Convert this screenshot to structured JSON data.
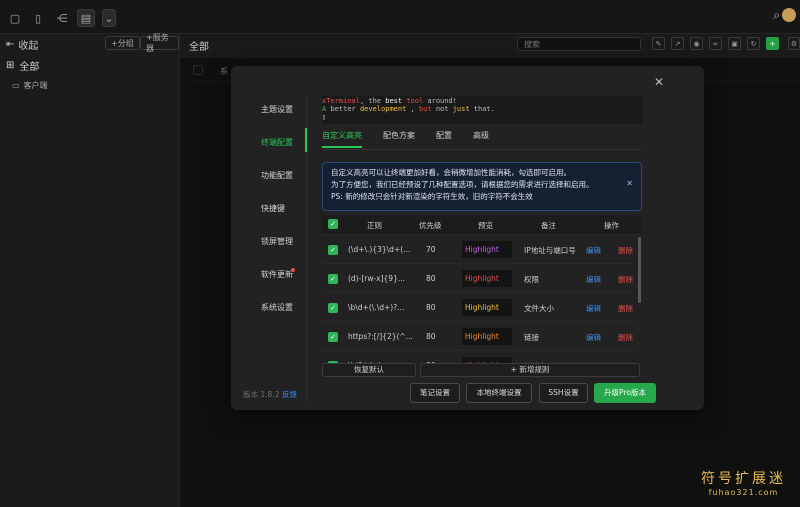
{
  "topbar": {
    "buttons": [
      "terminal-icon",
      "file-icon",
      "tree-icon",
      "list-icon",
      "chevron-down-icon"
    ]
  },
  "sidebar": {
    "collapse_label": "收起",
    "add_group_label": "+分组",
    "add_server_label": "+服务器",
    "all_label": "全部",
    "group_label": "客户端"
  },
  "main": {
    "title": "全部",
    "search_placeholder": "搜索",
    "head_partial": "系"
  },
  "modal": {
    "nav": [
      {
        "label": "主题设置"
      },
      {
        "label": "终端配置"
      },
      {
        "label": "功能配置"
      },
      {
        "label": "快捷键"
      },
      {
        "label": "锁屏管理"
      },
      {
        "label": "软件更新"
      },
      {
        "label": "系统设置"
      }
    ],
    "terminal_preview": {
      "line1": [
        {
          "t": "xTerminal",
          "c": "#e0504e"
        },
        {
          "t": ", the ",
          "c": "#bbbbbb"
        },
        {
          "t": "best",
          "c": "#f0f0f0"
        },
        {
          "t": " ",
          "c": "#bbbbbb"
        },
        {
          "t": "tool",
          "c": "#e0504e"
        },
        {
          "t": " around!",
          "c": "#bbbbbb"
        }
      ],
      "line2": [
        {
          "t": "A",
          "c": "#31c45b"
        },
        {
          "t": " better ",
          "c": "#bbbbbb"
        },
        {
          "t": "development",
          "c": "#f0c040"
        },
        {
          "t": " ",
          "c": "#bbbbbb"
        },
        {
          "t": ", ",
          "c": "#bbbbbb"
        },
        {
          "t": "but",
          "c": "#e0504e"
        },
        {
          "t": " not ",
          "c": "#bbbbbb"
        },
        {
          "t": "just",
          "c": "#f0c040"
        },
        {
          "t": " that.",
          "c": "#bbbbbb"
        }
      ],
      "cursor": "▯"
    },
    "tabs": [
      "自定义高亮",
      "配色方案",
      "配置",
      "高级"
    ],
    "info": {
      "line1": "自定义高亮可以让终端更加好看，会稍微增加性能消耗，勾选即可启用。",
      "line2": "为了方便您，我们已经预设了几种配置选项，请根据您的需求进行选择和启用。",
      "line3": "PS: 新的修改只会针对新渲染的字符生效，旧的字符不会生效"
    },
    "grid": {
      "headers": [
        "正则",
        "优先级",
        "预览",
        "备注",
        "操作"
      ],
      "rows": [
        {
          "regex": "(\\d+\\.){3}\\d+(...",
          "priority": "70",
          "preview": "Highlight",
          "preview_color": "#c060e0",
          "note": "IP地址与端口号",
          "edit": "编辑",
          "del": "删除"
        },
        {
          "regex": "(d)-[rw-x]{9}...",
          "priority": "80",
          "preview": "Highlight",
          "preview_color": "#e0504e",
          "note": "权限",
          "edit": "编辑",
          "del": "删除"
        },
        {
          "regex": "\\b\\d+(\\.\\d+)?...",
          "priority": "80",
          "preview": "Highlight",
          "preview_color": "#f0c040",
          "note": "文件大小",
          "edit": "编辑",
          "del": "删除"
        },
        {
          "regex": "https?:[/]{2}(^...",
          "priority": "80",
          "preview": "Highlight",
          "preview_color": "#f08c30",
          "note": "链接",
          "edit": "编辑",
          "del": "删除"
        },
        {
          "regex": "\\b(?:\\d+)...",
          "priority": "80",
          "preview": "Highlight",
          "preview_color": "#e0504e",
          "note": "关键字",
          "edit": "编辑",
          "del": "删除"
        }
      ]
    },
    "restore_label": "恢复默认",
    "add_rule_label": "+ 新增规则",
    "version": "版本 1.8.2",
    "feedback": "反馈",
    "footer_buttons": {
      "notes": "笔记设置",
      "local_terminal": "本地终端设置",
      "ssh": "SSH设置",
      "upgrade": "升级Pro版本"
    }
  },
  "watermark": {
    "line1": "符号扩展迷",
    "line2": "fuhao321.com"
  }
}
